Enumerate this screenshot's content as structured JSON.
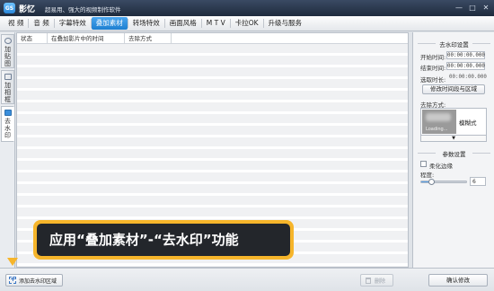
{
  "window": {
    "logo_text": "GS",
    "app_name": "影忆",
    "slogan": "超易用、强大的视频制作软件",
    "controls": [
      "—",
      "□",
      "✕"
    ]
  },
  "menu": {
    "items": [
      "视 频",
      "音 频",
      "字幕特效",
      "叠加素材",
      "转场特效",
      "画面风格",
      "M T V",
      "卡拉OK",
      "升级与服务"
    ],
    "active_index": 3
  },
  "side_tabs": [
    {
      "label": "加贴图",
      "icon": "sticker-icon"
    },
    {
      "label": "加相框",
      "icon": "frame-icon"
    },
    {
      "label": "去水印",
      "icon": "watermark-icon",
      "active": true
    }
  ],
  "list": {
    "headers": [
      "状态",
      "在叠加影片中的时间",
      "去除方式"
    ]
  },
  "right_panel": {
    "section1_title": "去水印设置",
    "start_label": "开始时间:",
    "start_value": "00:00:00.000",
    "end_label": "结束时间:",
    "end_value": "00:00:00.000",
    "duration_label": "选取时长:",
    "duration_value": "00:00:00.000",
    "modify_button": "修改时间段与区域",
    "remove_method_label": "去除方式:",
    "thumb_caption": "Loading...",
    "method_name": "模糊式",
    "dropdown_arrow": "▼",
    "section2_title": "参数设置",
    "soften_label": "柔化边缘",
    "soften_checked": false,
    "degree_label": "程度:",
    "degree_value": "6",
    "degree_fraction": 0.22
  },
  "bottom": {
    "add_button": "添加去水印区域",
    "delete_button": "删除",
    "confirm_button": "确认修改"
  },
  "callout": {
    "text": "应用“叠加素材”-“去水印”功能"
  },
  "colors": {
    "accent": "#1d7fd0",
    "callout_border": "#f6b52b",
    "callout_bg": "#23262b"
  }
}
